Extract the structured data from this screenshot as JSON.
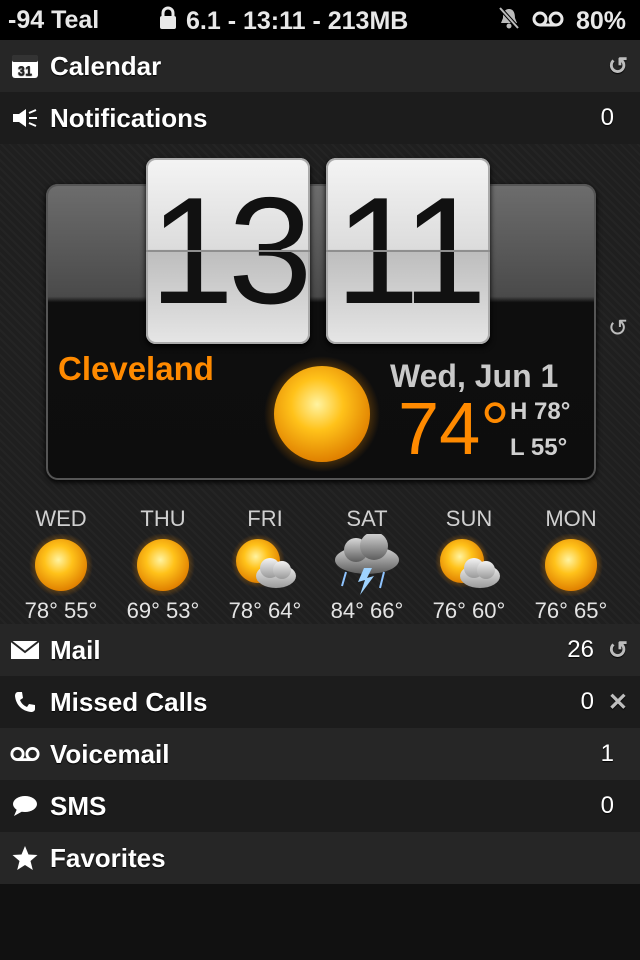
{
  "status": {
    "signal": "-94 Teal",
    "center": "6.1 - 13:11 - 213MB",
    "battery": "80%"
  },
  "rows": {
    "calendar": {
      "label": "Calendar",
      "icon": "calendar-icon"
    },
    "notifications": {
      "label": "Notifications",
      "value": "0",
      "icon": "speaker-icon"
    },
    "mail": {
      "label": "Mail",
      "value": "26",
      "icon": "envelope-icon"
    },
    "missed_calls": {
      "label": "Missed Calls",
      "value": "0",
      "icon": "phone-icon"
    },
    "voicemail": {
      "label": "Voicemail",
      "value": "1",
      "icon": "voicemail-icon"
    },
    "sms": {
      "label": "SMS",
      "value": "0",
      "icon": "speech-bubble-icon"
    },
    "favorites": {
      "label": "Favorites",
      "icon": "star-icon"
    }
  },
  "calendar_icon_day": "31",
  "clock": {
    "hours": "13",
    "minutes": "11"
  },
  "weather": {
    "city": "Cleveland",
    "date": "Wed, Jun 1",
    "temp": "74°",
    "high": "H 78°",
    "low": "L 55°",
    "condition_icon": "sun-icon"
  },
  "forecast": [
    {
      "day": "WED",
      "temps": "78° 55°",
      "icon": "sun-icon"
    },
    {
      "day": "THU",
      "temps": "69° 53°",
      "icon": "sun-icon"
    },
    {
      "day": "FRI",
      "temps": "78° 64°",
      "icon": "partly-cloudy-icon"
    },
    {
      "day": "SAT",
      "temps": "84° 66°",
      "icon": "thunderstorm-icon"
    },
    {
      "day": "SUN",
      "temps": "76° 60°",
      "icon": "partly-cloudy-icon"
    },
    {
      "day": "MON",
      "temps": "76° 65°",
      "icon": "sun-icon"
    }
  ],
  "colors": {
    "accent": "#ff8a00",
    "sun": "#ffb300"
  }
}
